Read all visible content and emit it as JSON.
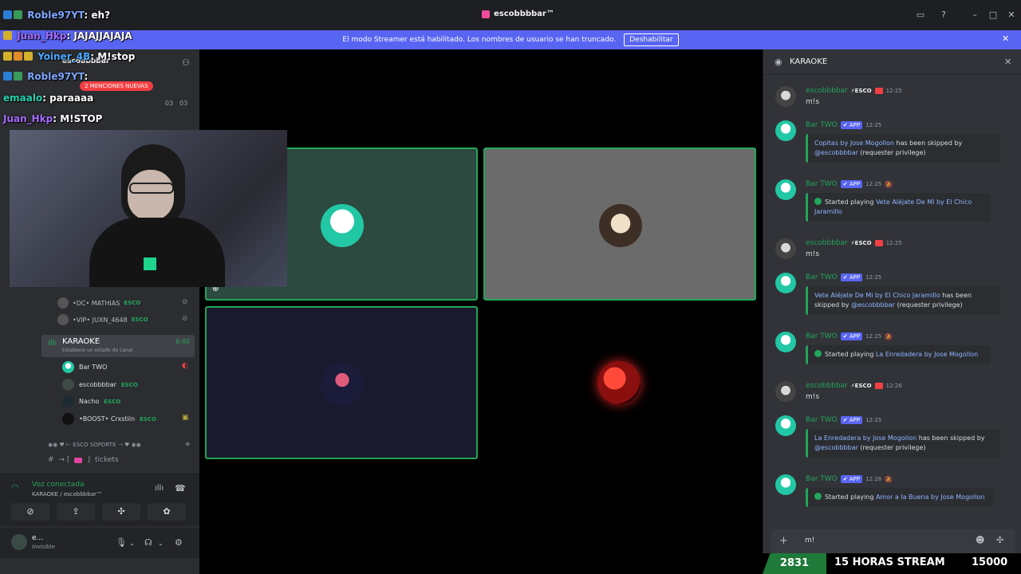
{
  "window": {
    "title": "escobbbbar™"
  },
  "banner": {
    "text": "El modo Streamer está habilitado. Los nombres de usuario se han truncado.",
    "disable_label": "Deshabilitar"
  },
  "overlay_chat": [
    {
      "user": "Roble97YT",
      "message": ": eh?"
    },
    {
      "user": "Juan_Hkp",
      "message": ": JAJAJJAJAJA"
    },
    {
      "user": "Yoiner_4B",
      "message": ": M!stop"
    },
    {
      "user": "Roble97YT",
      "message": ": "
    },
    {
      "user": "emaalo",
      "message": ": paraaaa"
    },
    {
      "user": "Juan_Hkp",
      "message": ": M!STOP"
    }
  ],
  "sidebar": {
    "server_name": "escobbbbar",
    "mentions_pill": "2 MENCIONES NUEVAS",
    "counter_a": "03",
    "counter_b": "03",
    "members": [
      {
        "name": "•DC• MATHIAS",
        "tag": "ESCO"
      },
      {
        "name": "•VIP• JUXN_4648",
        "tag": "ESCO"
      }
    ],
    "karaoke_channel": {
      "name": "KARAOKE",
      "status": "Establece un estado de canal",
      "time": "6:40"
    },
    "voice_members": [
      {
        "name": "Bar TWO",
        "tag": ""
      },
      {
        "name": "escobbbbar",
        "tag": "ESCO"
      },
      {
        "name": "Nacho",
        "tag": "ESCO"
      },
      {
        "name": "•BOOST• Crxstiin",
        "tag": "ESCO"
      }
    ],
    "category": "ESCO SOPORTE",
    "tickets_channel": "tickets",
    "voice_panel": {
      "connected": "Voz conectada",
      "location": "KARAOKE / escobbbbar™"
    },
    "user": {
      "name": "e...",
      "status": "Invisible"
    }
  },
  "chat": {
    "channel_title": "KARAOKE",
    "messages": [
      {
        "author": "escobbbbar",
        "tag": "ESCO",
        "time": "12:25",
        "body": "m!s"
      },
      {
        "author": "Bar TWO",
        "app": "APP",
        "time": "12:25",
        "embed_link": "Copitas by Jose Mogollon",
        "embed_text": " has been skipped by ",
        "embed_mention": "@escobbbbar",
        "embed_tail": " (requester privilege)"
      },
      {
        "author": "Bar TWO",
        "app": "APP",
        "time": "12:25",
        "embed_prefix": "Started playing ",
        "embed_link": "Vete Aléjate De Mi by El Chico Jaramillo"
      },
      {
        "author": "escobbbbar",
        "tag": "ESCO",
        "time": "12:25",
        "body": "m!s"
      },
      {
        "author": "Bar TWO",
        "app": "APP",
        "time": "12:25",
        "embed_link": "Vete Aléjate De Mi by El Chico Jaramillo",
        "embed_text": " has been skipped by ",
        "embed_mention": "@escobbbbar",
        "embed_tail": " (requester privilege)"
      },
      {
        "author": "Bar TWO",
        "app": "APP",
        "time": "12:25",
        "embed_prefix": "Started playing ",
        "embed_link": "La Enredadera by Jose Mogollon"
      },
      {
        "author": "escobbbbar",
        "tag": "ESCO",
        "time": "12:26",
        "body": "m!s"
      },
      {
        "author": "Bar TWO",
        "app": "APP",
        "time": "12:25",
        "embed_link": "La Enredadera by Jose Mogollon",
        "embed_text": " has been skipped by ",
        "embed_mention": "@escobbbbar",
        "embed_tail": " (requester privilege)"
      },
      {
        "author": "Bar TWO",
        "app": "APP",
        "time": "12:26",
        "embed_prefix": "Started playing ",
        "embed_link": "Amor a la Buena by Jose Mogollon"
      }
    ],
    "input_value": "m!"
  },
  "stream_bar": {
    "left_count": "2831",
    "label": "15 HORAS STREAM",
    "right_count": "15000"
  },
  "colors": {
    "accent": "#5865f2",
    "online": "#23a55a",
    "live": "#f23f43"
  }
}
